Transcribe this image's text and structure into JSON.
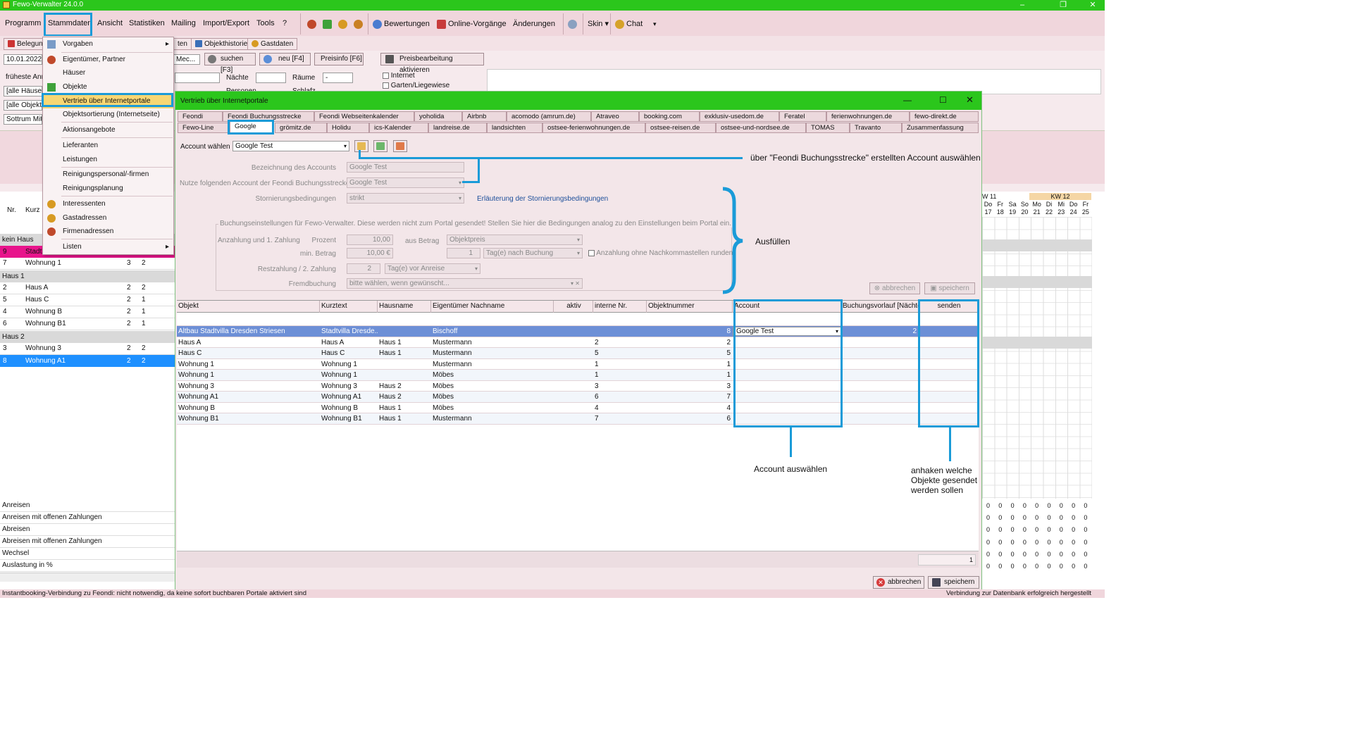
{
  "window": {
    "title": "Fewo-Verwalter 24.0.0",
    "minimize": "–",
    "maximize": "❐",
    "close": "✕"
  },
  "menubar": {
    "items": [
      "Programm",
      "Stammdaten",
      "Ansicht",
      "Statistiken",
      "Mailing",
      "Import/Export",
      "Tools",
      "?"
    ],
    "bewertungen": "Bewertungen",
    "online_vorgaenge": "Online-Vorgänge",
    "aenderungen": "Änderungen",
    "skin": "Skin ▾",
    "chat": "Chat",
    "overflow": "▾"
  },
  "row2": {
    "belegung": "Belegung",
    "tab_hidden": "ten",
    "objekthistorie": "Objekthistorie",
    "gastdaten": "Gastdaten"
  },
  "search_row": {
    "date": "10.01.2022",
    "mec": "Mec...",
    "suchen": "suchen [F3]",
    "neu": "neu [F4]",
    "preisinfo": "Preisinfo [F6]",
    "preisbearbeitung": "Preisbearbeitung aktivieren"
  },
  "filters": {
    "frueheste": "früheste Anre",
    "haeuser": "[alle Häuser]",
    "objekte": "[alle Objekte",
    "sottrum": "Sottrum Mitte",
    "naechte_label": "Nächte",
    "raeume_label": "Räume",
    "raeume_value": "-",
    "personen_label": "Personen",
    "schlafz_label": "Schlafz.",
    "internet": "Internet",
    "garten": "Garten/Liegewiese"
  },
  "stammdaten_menu": {
    "items": [
      {
        "label": "Vorgaben",
        "arrow": "▸"
      },
      {
        "label": "Eigentümer, Partner"
      },
      {
        "label": "Häuser"
      },
      {
        "label": "Objekte"
      },
      {
        "label": "Vertrieb über Internetportale"
      },
      {
        "label": "Objektsortierung (Internetseite)"
      },
      {
        "label": "Aktionsangebote"
      },
      {
        "label": "Lieferanten"
      },
      {
        "label": "Leistungen"
      },
      {
        "label": "Reinigungspersonal/-firmen"
      },
      {
        "label": "Reinigungsplanung"
      },
      {
        "label": "Interessenten"
      },
      {
        "label": "Gastadressen"
      },
      {
        "label": "Firmenadressen"
      },
      {
        "label": "Listen",
        "arrow": "▸"
      }
    ]
  },
  "leftlist": {
    "header": {
      "nr": "Nr.",
      "kurz": "Kurz"
    },
    "rows": [
      {
        "type": "group",
        "label": "kein Haus"
      },
      {
        "type": "row",
        "nr": "9",
        "kurz": "Stadtb",
        "a": "",
        "b": "",
        "style": "pink"
      },
      {
        "type": "row",
        "nr": "7",
        "kurz": "Wohnung 1",
        "a": "3",
        "b": "2"
      },
      {
        "type": "group",
        "label": "Haus 1"
      },
      {
        "type": "row",
        "nr": "2",
        "kurz": "Haus A",
        "a": "2",
        "b": "2"
      },
      {
        "type": "row",
        "nr": "5",
        "kurz": "Haus C",
        "a": "2",
        "b": "1"
      },
      {
        "type": "row",
        "nr": "4",
        "kurz": "Wohnung B",
        "a": "2",
        "b": "1"
      },
      {
        "type": "row",
        "nr": "6",
        "kurz": "Wohnung B1",
        "a": "2",
        "b": "1"
      },
      {
        "type": "group",
        "label": "Haus 2"
      },
      {
        "type": "row",
        "nr": "3",
        "kurz": "Wohnung 3",
        "a": "2",
        "b": "2"
      },
      {
        "type": "row",
        "nr": "8",
        "kurz": "Wohnung A1",
        "a": "2",
        "b": "2",
        "style": "selected"
      }
    ],
    "bottom": [
      "Anreisen",
      "Anreisen mit offenen Zahlungen",
      "Abreisen",
      "Abreisen mit offenen Zahlungen",
      "Wechsel",
      "Auslastung in %"
    ]
  },
  "dialog": {
    "title": "Vertrieb über Internetportale",
    "tabs_row1": [
      "Feondi",
      "Feondi Buchungsstrecke",
      "Feondi Webseitenkalender",
      "yoholida",
      "Airbnb",
      "acomodo (amrum.de)",
      "Atraveo",
      "booking.com",
      "exklusiv-usedom.de",
      "Feratel",
      "ferienwohnungen.de",
      "fewo-direkt.de"
    ],
    "tabs_row2": [
      "Fewo-Line",
      "Google",
      "grömitz.de",
      "Holidu",
      "ics-Kalender",
      "landreise.de",
      "landsichten",
      "ostsee-ferienwohnungen.de",
      "ostsee-reisen.de",
      "ostsee-und-nordsee.de",
      "TOMAS",
      "Travanto",
      "Zusammenfassung"
    ],
    "account_label": "Account wählen",
    "account_value": "Google Test",
    "bezeichnung_label": "Bezeichnung des Accounts",
    "bezeichnung_value": "Google Test",
    "nutze_label": "Nutze folgenden Account der Feondi Buchungsstrecke",
    "nutze_value": "Google Test",
    "storno_label": "Stornierungsbedingungen",
    "storno_value": "strikt",
    "storno_link": "Erläuterung der Stornierungsbedingungen",
    "settings_note": "Buchungseinstellungen für Fewo-Verwalter. Diese werden nicht zum Portal gesendet! Stellen Sie hier die Bedingungen analog zu den Einstellungen beim Portal ein.",
    "anzahlung_label": "Anzahlung und 1. Zahlung",
    "prozent_label": "Prozent",
    "prozent_value": "10,00",
    "aus_betrag_label": "aus Betrag",
    "aus_betrag_value": "Objektpreis",
    "min_betrag_label": "min. Betrag",
    "min_betrag_value": "10,00 €",
    "tage_value": "1",
    "tage_unit": "Tag(e) nach Buchung",
    "runden_label": "Anzahlung ohne Nachkommastellen runden",
    "rest_label": "Restzahlung / 2. Zahlung",
    "rest_value": "2",
    "rest_unit": "Tag(e) vor Anreise",
    "fremd_label": "Fremdbuchung",
    "fremd_value": "bitte wählen, wenn gewünscht...",
    "abbrechen_small": "abbrechen",
    "speichern_small": "speichern",
    "grid": {
      "headers": [
        "Objekt",
        "Kurztext",
        "Hausname",
        "Eigentümer Nachname",
        "aktiv",
        "interne Nr.",
        "Objektnummer",
        "Account",
        "Buchungsvorlauf [Nächte]",
        "senden"
      ],
      "rows": [
        {
          "objekt": "Altbau Stadtvilla Dresden Striesen",
          "kurz": "Stadtvilla Dresde...",
          "haus": "",
          "eig": "Bischoff",
          "aktiv": true,
          "intern": "",
          "objnr": "8",
          "account": "Google Test",
          "vorlauf": "2",
          "senden": true
        },
        {
          "objekt": "Haus A",
          "kurz": "Haus A",
          "haus": "Haus 1",
          "eig": "Mustermann",
          "aktiv": true,
          "intern": "2",
          "objnr": "2",
          "account": "",
          "vorlauf": "",
          "senden": false
        },
        {
          "objekt": "Haus C",
          "kurz": "Haus C",
          "haus": "Haus 1",
          "eig": "Mustermann",
          "aktiv": true,
          "intern": "5",
          "objnr": "5",
          "account": "",
          "vorlauf": "",
          "senden": false
        },
        {
          "objekt": "Wohnung 1",
          "kurz": "Wohnung 1",
          "haus": "",
          "eig": "Mustermann",
          "aktiv": false,
          "intern": "1",
          "objnr": "1",
          "account": "",
          "vorlauf": "",
          "senden": false
        },
        {
          "objekt": "Wohnung 1",
          "kurz": "Wohnung 1",
          "haus": "",
          "eig": "Möbes",
          "aktiv": true,
          "intern": "1",
          "objnr": "1",
          "account": "",
          "vorlauf": "",
          "senden": false
        },
        {
          "objekt": "Wohnung 3",
          "kurz": "Wohnung 3",
          "haus": "Haus 2",
          "eig": "Möbes",
          "aktiv": true,
          "intern": "3",
          "objnr": "3",
          "account": "",
          "vorlauf": "",
          "senden": false
        },
        {
          "objekt": "Wohnung A1",
          "kurz": "Wohnung A1",
          "haus": "Haus 2",
          "eig": "Möbes",
          "aktiv": true,
          "intern": "6",
          "objnr": "7",
          "account": "",
          "vorlauf": "",
          "senden": false
        },
        {
          "objekt": "Wohnung B",
          "kurz": "Wohnung B",
          "haus": "Haus 1",
          "eig": "Möbes",
          "aktiv": true,
          "intern": "4",
          "objnr": "4",
          "account": "",
          "vorlauf": "",
          "senden": false
        },
        {
          "objekt": "Wohnung B1",
          "kurz": "Wohnung B1",
          "haus": "Haus 1",
          "eig": "Mustermann",
          "aktiv": true,
          "intern": "7",
          "objnr": "6",
          "account": "",
          "vorlauf": "",
          "senden": false
        }
      ],
      "footer_count": "1"
    },
    "abbrechen": "abbrechen",
    "speichern": "speichern"
  },
  "annotations": {
    "account_auswahl": "über \"Feondi Buchungsstrecke\" erstellten Account auswählen",
    "ausfuellen": "Ausfüllen",
    "account_waehlen": "Account auswählen",
    "anhaken": "anhaken welche\nObjekte gesendet\nwerden sollen"
  },
  "calendar": {
    "kw11": "W 11",
    "kw12": "KW 12",
    "days": [
      "Do",
      "Fr",
      "Sa",
      "So",
      "Mo",
      "Di",
      "Mi",
      "Do",
      "Fr"
    ],
    "dates": [
      "17",
      "18",
      "19",
      "20",
      "21",
      "22",
      "23",
      "24",
      "25"
    ],
    "zero": "0"
  },
  "statusbar": {
    "left": "Instantbooking-Verbindung zu Feondi: nicht notwendig, da keine sofort buchbaren Portale aktiviert sind",
    "right": "Verbindung zur Datenbank erfolgreich hergestellt"
  },
  "colors": {
    "green": "#2bc61c",
    "blue_highlight": "#1a9bd8",
    "pink": "#f0d6dc",
    "selected": "#1e90ff",
    "magenta": "#e8148c"
  }
}
